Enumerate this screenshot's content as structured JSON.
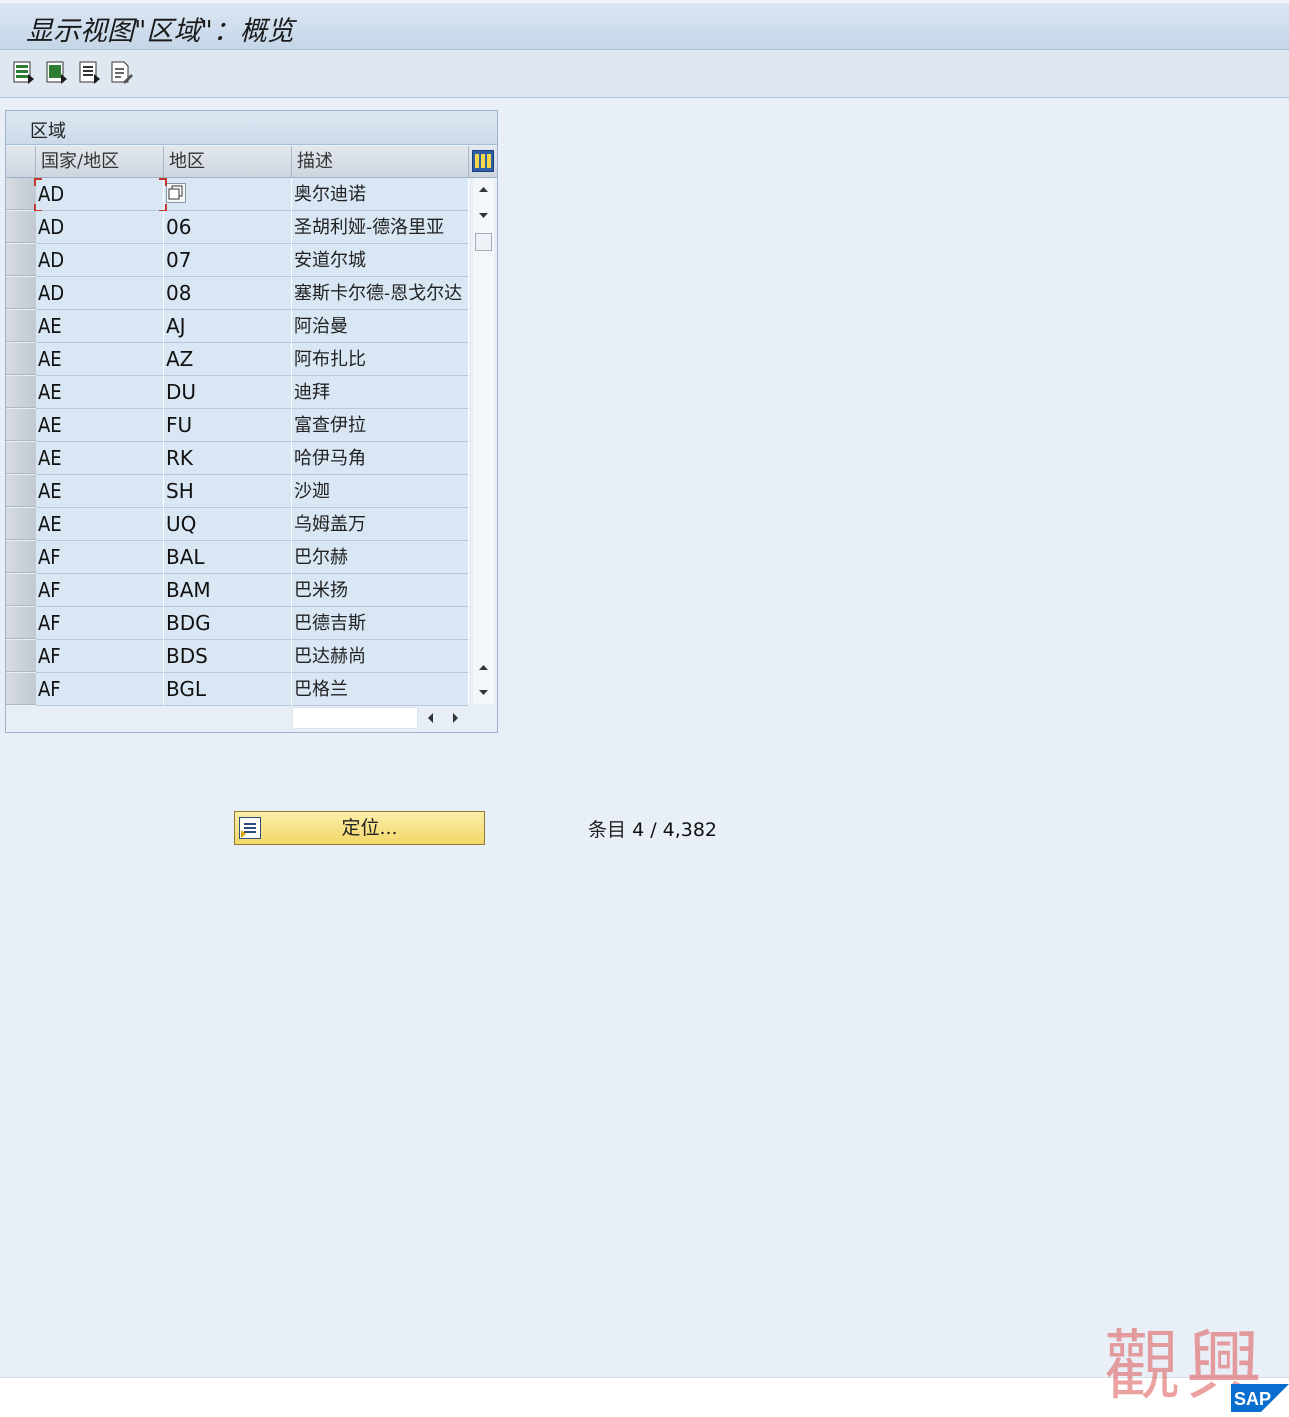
{
  "window": {
    "title": "显示视图\"区域\"：概览"
  },
  "toolbar": {
    "buttons": [
      {
        "icon": "table-view-icon"
      },
      {
        "icon": "export-icon"
      },
      {
        "icon": "details-icon"
      },
      {
        "icon": "print-preview-icon"
      }
    ]
  },
  "table": {
    "caption": "区域",
    "columns": [
      "国家/地区",
      "地区",
      "描述"
    ],
    "rows": [
      {
        "country": "AD",
        "region": "",
        "description": "奥尔迪诺"
      },
      {
        "country": "AD",
        "region": "06",
        "description": "圣胡利娅-德洛里亚"
      },
      {
        "country": "AD",
        "region": "07",
        "description": "安道尔城"
      },
      {
        "country": "AD",
        "region": "08",
        "description": "塞斯卡尔德-恩戈尔达"
      },
      {
        "country": "AE",
        "region": "AJ",
        "description": "阿治曼"
      },
      {
        "country": "AE",
        "region": "AZ",
        "description": "阿布扎比"
      },
      {
        "country": "AE",
        "region": "DU",
        "description": "迪拜"
      },
      {
        "country": "AE",
        "region": "FU",
        "description": "富查伊拉"
      },
      {
        "country": "AE",
        "region": "RK",
        "description": "哈伊马角"
      },
      {
        "country": "AE",
        "region": "SH",
        "description": "沙迦"
      },
      {
        "country": "AE",
        "region": "UQ",
        "description": "乌姆盖万"
      },
      {
        "country": "AF",
        "region": "BAL",
        "description": "巴尔赫"
      },
      {
        "country": "AF",
        "region": "BAM",
        "description": "巴米扬"
      },
      {
        "country": "AF",
        "region": "BDG",
        "description": "巴德吉斯"
      },
      {
        "country": "AF",
        "region": "BDS",
        "description": "巴达赫尚"
      },
      {
        "country": "AF",
        "region": "BGL",
        "description": "巴格兰"
      }
    ]
  },
  "position_button": {
    "label": "定位..."
  },
  "entry_count": {
    "label": "条目",
    "value": "4 / 4,382"
  },
  "watermark": {
    "text": "觀興"
  },
  "logo": {
    "text": "SAP"
  },
  "colors": {
    "accent": "#f3d76a",
    "cell_bg": "#d9e6f4",
    "background": "#e9eff6"
  }
}
